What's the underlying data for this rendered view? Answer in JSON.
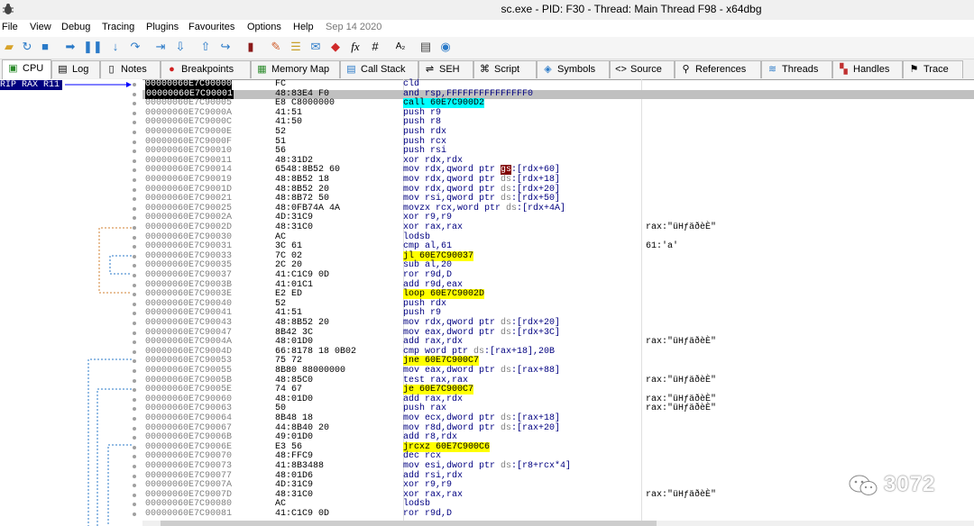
{
  "window": {
    "title": "sc.exe - PID: F30 - Thread: Main Thread F98 - x64dbg"
  },
  "menu": [
    "File",
    "View",
    "Debug",
    "Tracing",
    "Plugins",
    "Favourites",
    "Options",
    "Help"
  ],
  "menu_date": "Sep 14 2020",
  "toolbar": {
    "icons": [
      "open-icon",
      "restart-icon",
      "stop-icon",
      "run-icon",
      "pause-icon",
      "step-into-icon",
      "step-over-icon",
      "trace-into-icon",
      "trace-over-icon",
      "execute-till-return-icon",
      "run-to-user-code-icon",
      "scylla-icon",
      "patches-icon",
      "comments-icon",
      "labels-icon",
      "bookmarks-icon",
      "functions-icon",
      "variables-icon",
      "strings-icon",
      "calculator-icon",
      "plugin-icon"
    ],
    "fx_label": "fx",
    "hash_label": "#",
    "az_label": "A₂"
  },
  "tabs": [
    {
      "label": "CPU",
      "icon": "cpu-icon"
    },
    {
      "label": "Log",
      "icon": "log-icon"
    },
    {
      "label": "Notes",
      "icon": "notes-icon"
    },
    {
      "label": "Breakpoints",
      "icon": "breakpoint-icon"
    },
    {
      "label": "Memory Map",
      "icon": "memory-map-icon"
    },
    {
      "label": "Call Stack",
      "icon": "call-stack-icon"
    },
    {
      "label": "SEH",
      "icon": "seh-icon"
    },
    {
      "label": "Script",
      "icon": "script-icon"
    },
    {
      "label": "Symbols",
      "icon": "symbols-icon"
    },
    {
      "label": "Source",
      "icon": "source-icon"
    },
    {
      "label": "References",
      "icon": "references-icon"
    },
    {
      "label": "Threads",
      "icon": "threads-icon"
    },
    {
      "label": "Handles",
      "icon": "handles-icon"
    },
    {
      "label": "Trace",
      "icon": "trace-icon"
    }
  ],
  "rip_label": "RIP RAX R11",
  "rows": [
    {
      "addr": "00000060E7C90000",
      "bytes": "FC",
      "pre": "cld",
      "hl": "",
      "post": "",
      "cmt": ""
    },
    {
      "addr": "00000060E7C90001",
      "bytes": "48:83E4 F0",
      "pre": "and rsp,FFFFFFFFFFFFFFF0",
      "hl": "",
      "post": "",
      "cmt": ""
    },
    {
      "addr": "00000060E7C90005",
      "bytes": "E8 C8000000",
      "pre": "",
      "hl": "call 60E7C900D2",
      "hlc": "cyan",
      "post": "",
      "cmt": ""
    },
    {
      "addr": "00000060E7C9000A",
      "bytes": "41:51",
      "pre": "push r9",
      "hl": "",
      "post": "",
      "cmt": ""
    },
    {
      "addr": "00000060E7C9000C",
      "bytes": "41:50",
      "pre": "push r8",
      "hl": "",
      "post": "",
      "cmt": ""
    },
    {
      "addr": "00000060E7C9000E",
      "bytes": "52",
      "pre": "push rdx",
      "hl": "",
      "post": "",
      "cmt": ""
    },
    {
      "addr": "00000060E7C9000F",
      "bytes": "51",
      "pre": "push rcx",
      "hl": "",
      "post": "",
      "cmt": ""
    },
    {
      "addr": "00000060E7C90010",
      "bytes": "56",
      "pre": "push rsi",
      "hl": "",
      "post": "",
      "cmt": ""
    },
    {
      "addr": "00000060E7C90011",
      "bytes": "48:31D2",
      "pre": "xor rdx,rdx",
      "hl": "",
      "post": "",
      "cmt": ""
    },
    {
      "addr": "00000060E7C90014",
      "bytes": "6548:8B52 60",
      "pre": "mov rdx,qword ptr ",
      "seg": "gs",
      "segc": "dark",
      "post": ":[rdx+60]",
      "cmt": ""
    },
    {
      "addr": "00000060E7C90019",
      "bytes": "48:8B52 18",
      "pre": "mov rdx,qword ptr ",
      "seg": "ds",
      "post": ":[rdx+18]",
      "cmt": ""
    },
    {
      "addr": "00000060E7C9001D",
      "bytes": "48:8B52 20",
      "pre": "mov rdx,qword ptr ",
      "seg": "ds",
      "post": ":[rdx+20]",
      "cmt": ""
    },
    {
      "addr": "00000060E7C90021",
      "bytes": "48:8B72 50",
      "pre": "mov rsi,qword ptr ",
      "seg": "ds",
      "post": ":[rdx+50]",
      "cmt": ""
    },
    {
      "addr": "00000060E7C90025",
      "bytes": "48:0FB74A 4A",
      "pre": "movzx rcx,word ptr ",
      "seg": "ds",
      "post": ":[rdx+4A]",
      "cmt": ""
    },
    {
      "addr": "00000060E7C9002A",
      "bytes": "4D:31C9",
      "pre": "xor r9,r9",
      "hl": "",
      "post": "",
      "cmt": ""
    },
    {
      "addr": "00000060E7C9002D",
      "bytes": "48:31C0",
      "pre": "xor rax,rax",
      "hl": "",
      "post": "",
      "cmt": "rax:\"üHƒäðèÈ\""
    },
    {
      "addr": "00000060E7C90030",
      "bytes": "AC",
      "pre": "lodsb",
      "hl": "",
      "post": "",
      "cmt": ""
    },
    {
      "addr": "00000060E7C90031",
      "bytes": "3C 61",
      "pre": "cmp al,61",
      "hl": "",
      "post": "",
      "cmt": "61:'a'"
    },
    {
      "addr": "00000060E7C90033",
      "bytes": "7C 02",
      "pre": "",
      "hl": "jl 60E7C90037",
      "hlc": "yellow",
      "post": "",
      "cmt": ""
    },
    {
      "addr": "00000060E7C90035",
      "bytes": "2C 20",
      "pre": "sub al,20",
      "hl": "",
      "post": "",
      "cmt": ""
    },
    {
      "addr": "00000060E7C90037",
      "bytes": "41:C1C9 0D",
      "pre": "ror r9d,D",
      "hl": "",
      "post": "",
      "cmt": ""
    },
    {
      "addr": "00000060E7C9003B",
      "bytes": "41:01C1",
      "pre": "add r9d,eax",
      "hl": "",
      "post": "",
      "cmt": ""
    },
    {
      "addr": "00000060E7C9003E",
      "bytes": "E2 ED",
      "pre": "",
      "hl": "loop 60E7C9002D",
      "hlc": "yellow",
      "post": "",
      "cmt": ""
    },
    {
      "addr": "00000060E7C90040",
      "bytes": "52",
      "pre": "push rdx",
      "hl": "",
      "post": "",
      "cmt": ""
    },
    {
      "addr": "00000060E7C90041",
      "bytes": "41:51",
      "pre": "push r9",
      "hl": "",
      "post": "",
      "cmt": ""
    },
    {
      "addr": "00000060E7C90043",
      "bytes": "48:8B52 20",
      "pre": "mov rdx,qword ptr ",
      "seg": "ds",
      "post": ":[rdx+20]",
      "cmt": ""
    },
    {
      "addr": "00000060E7C90047",
      "bytes": "8B42 3C",
      "pre": "mov eax,dword ptr ",
      "seg": "ds",
      "post": ":[rdx+3C]",
      "cmt": ""
    },
    {
      "addr": "00000060E7C9004A",
      "bytes": "48:01D0",
      "pre": "add rax,rdx",
      "hl": "",
      "post": "",
      "cmt": "rax:\"üHƒäðèÈ\""
    },
    {
      "addr": "00000060E7C9004D",
      "bytes": "66:8178 18 0B02",
      "pre": "cmp word ptr ",
      "seg": "ds",
      "post": ":[rax+18],20B",
      "cmt": ""
    },
    {
      "addr": "00000060E7C90053",
      "bytes": "75 72",
      "pre": "",
      "hl": "jne 60E7C900C7",
      "hlc": "yellow",
      "post": "",
      "cmt": ""
    },
    {
      "addr": "00000060E7C90055",
      "bytes": "8B80 88000000",
      "pre": "mov eax,dword ptr ",
      "seg": "ds",
      "post": ":[rax+88]",
      "cmt": ""
    },
    {
      "addr": "00000060E7C9005B",
      "bytes": "48:85C0",
      "pre": "test rax,rax",
      "hl": "",
      "post": "",
      "cmt": "rax:\"üHƒäðèÈ\""
    },
    {
      "addr": "00000060E7C9005E",
      "bytes": "74 67",
      "pre": "",
      "hl": "je 60E7C900C7",
      "hlc": "yellow",
      "post": "",
      "cmt": ""
    },
    {
      "addr": "00000060E7C90060",
      "bytes": "48:01D0",
      "pre": "add rax,rdx",
      "hl": "",
      "post": "",
      "cmt": "rax:\"üHƒäðèÈ\""
    },
    {
      "addr": "00000060E7C90063",
      "bytes": "50",
      "pre": "push rax",
      "hl": "",
      "post": "",
      "cmt": "rax:\"üHƒäðèÈ\""
    },
    {
      "addr": "00000060E7C90064",
      "bytes": "8B48 18",
      "pre": "mov ecx,dword ptr ",
      "seg": "ds",
      "post": ":[rax+18]",
      "cmt": ""
    },
    {
      "addr": "00000060E7C90067",
      "bytes": "44:8B40 20",
      "pre": "mov r8d,dword ptr ",
      "seg": "ds",
      "post": ":[rax+20]",
      "cmt": ""
    },
    {
      "addr": "00000060E7C9006B",
      "bytes": "49:01D0",
      "pre": "add r8,rdx",
      "hl": "",
      "post": "",
      "cmt": ""
    },
    {
      "addr": "00000060E7C9006E",
      "bytes": "E3 56",
      "pre": "",
      "hl": "jrcxz 60E7C900C6",
      "hlc": "yellow",
      "post": "",
      "cmt": ""
    },
    {
      "addr": "00000060E7C90070",
      "bytes": "48:FFC9",
      "pre": "dec rcx",
      "hl": "",
      "post": "",
      "cmt": ""
    },
    {
      "addr": "00000060E7C90073",
      "bytes": "41:8B3488",
      "pre": "mov esi,dword ptr ",
      "seg": "ds",
      "post": ":[r8+rcx*4]",
      "cmt": ""
    },
    {
      "addr": "00000060E7C90077",
      "bytes": "48:01D6",
      "pre": "add rsi,rdx",
      "hl": "",
      "post": "",
      "cmt": ""
    },
    {
      "addr": "00000060E7C9007A",
      "bytes": "4D:31C9",
      "pre": "xor r9,r9",
      "hl": "",
      "post": "",
      "cmt": ""
    },
    {
      "addr": "00000060E7C9007D",
      "bytes": "48:31C0",
      "pre": "xor rax,rax",
      "hl": "",
      "post": "",
      "cmt": "rax:\"üHƒäðèÈ\""
    },
    {
      "addr": "00000060E7C90080",
      "bytes": "AC",
      "pre": "lodsb",
      "hl": "",
      "post": "",
      "cmt": ""
    },
    {
      "addr": "00000060E7C90081",
      "bytes": "41:C1C9 0D",
      "pre": "ror r9d,D",
      "hl": "",
      "post": "",
      "cmt": ""
    }
  ],
  "watermark": {
    "text": "3072",
    "icon": "wechat-icon"
  }
}
